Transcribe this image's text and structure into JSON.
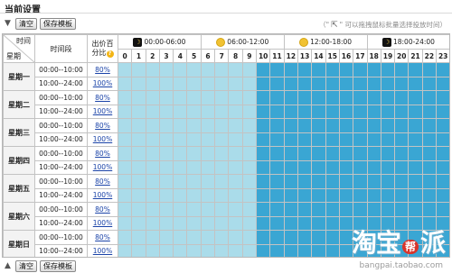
{
  "page": {
    "title": "当前设置"
  },
  "toolbar": {
    "clear_label": "清空",
    "save_template_label": "保存模板"
  },
  "hint": {
    "prefix": "（\"",
    "suffix": "\" 可以拖拽鼠标批量选择投放时间）"
  },
  "header": {
    "corner_time": "时间",
    "corner_week": "星期",
    "time_slot": "时间段",
    "bid_pct_line1": "出价百",
    "bid_pct_line2": "分比",
    "segments": [
      {
        "label": "00:00-06:00",
        "icon": "moon-icon"
      },
      {
        "label": "06:00-12:00",
        "icon": "sun-icon"
      },
      {
        "label": "12:00-18:00",
        "icon": "sun-icon"
      },
      {
        "label": "18:00-24:00",
        "icon": "moon-icon"
      }
    ],
    "hours": [
      "0",
      "1",
      "2",
      "3",
      "4",
      "5",
      "6",
      "7",
      "8",
      "9",
      "10",
      "11",
      "12",
      "13",
      "14",
      "15",
      "16",
      "17",
      "18",
      "19",
      "20",
      "21",
      "22",
      "23"
    ]
  },
  "days": [
    {
      "name": "星期一",
      "slots": [
        {
          "time": "00:00--10:00",
          "pct": "80%"
        },
        {
          "time": "10:00--24:00",
          "pct": "100%"
        }
      ]
    },
    {
      "name": "星期二",
      "slots": [
        {
          "time": "00:00--10:00",
          "pct": "80%"
        },
        {
          "time": "10:00--24:00",
          "pct": "100%"
        }
      ]
    },
    {
      "name": "星期三",
      "slots": [
        {
          "time": "00:00--10:00",
          "pct": "80%"
        },
        {
          "time": "10:00--24:00",
          "pct": "100%"
        }
      ]
    },
    {
      "name": "星期四",
      "slots": [
        {
          "time": "00:00--10:00",
          "pct": "80%"
        },
        {
          "time": "10:00--24:00",
          "pct": "100%"
        }
      ]
    },
    {
      "name": "星期五",
      "slots": [
        {
          "time": "00:00--10:00",
          "pct": "80%"
        },
        {
          "time": "10:00--24:00",
          "pct": "100%"
        }
      ]
    },
    {
      "name": "星期六",
      "slots": [
        {
          "time": "00:00--10:00",
          "pct": "80%"
        },
        {
          "time": "10:00--24:00",
          "pct": "100%"
        }
      ]
    },
    {
      "name": "星期日",
      "slots": [
        {
          "time": "00:00--10:00",
          "pct": "80%"
        },
        {
          "time": "10:00--24:00",
          "pct": "100%"
        }
      ]
    }
  ],
  "cell_levels": {
    "hours_0_to_9": "80%",
    "hours_10_to_23": "100%"
  },
  "colors": {
    "level_80": "#aadcea",
    "level_100": "#3aa6d3",
    "link": "#1a43a8"
  },
  "watermark": {
    "text": "淘宝",
    "badge": "帮",
    "text2": "派",
    "url": "bangpai.taobao.com"
  }
}
